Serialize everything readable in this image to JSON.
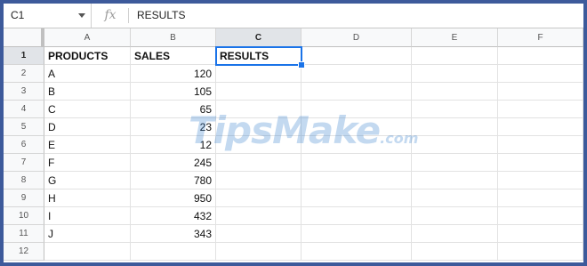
{
  "formula_bar": {
    "name_box": "C1",
    "fx_symbol": "fx",
    "content": "RESULTS"
  },
  "columns": [
    "A",
    "B",
    "C",
    "D",
    "E",
    "F"
  ],
  "selected_column": "C",
  "rows": [
    {
      "num": "1",
      "a": "PRODUCTS",
      "b": "SALES",
      "c": "RESULTS"
    },
    {
      "num": "2",
      "a": "A",
      "b": "120",
      "c": ""
    },
    {
      "num": "3",
      "a": "B",
      "b": "105",
      "c": ""
    },
    {
      "num": "4",
      "a": "C",
      "b": "65",
      "c": ""
    },
    {
      "num": "5",
      "a": "D",
      "b": "23",
      "c": ""
    },
    {
      "num": "6",
      "a": "E",
      "b": "12",
      "c": ""
    },
    {
      "num": "7",
      "a": "F",
      "b": "245",
      "c": ""
    },
    {
      "num": "8",
      "a": "G",
      "b": "780",
      "c": ""
    },
    {
      "num": "9",
      "a": "H",
      "b": "950",
      "c": ""
    },
    {
      "num": "10",
      "a": "I",
      "b": "432",
      "c": ""
    },
    {
      "num": "11",
      "a": "J",
      "b": "343",
      "c": ""
    },
    {
      "num": "12",
      "a": "",
      "b": "",
      "c": ""
    }
  ],
  "selected_row": "1",
  "watermark": {
    "main": "TipsMake",
    "suffix": ".com"
  },
  "colors": {
    "frame": "#3d5a9b",
    "selection": "#1a73e8"
  }
}
